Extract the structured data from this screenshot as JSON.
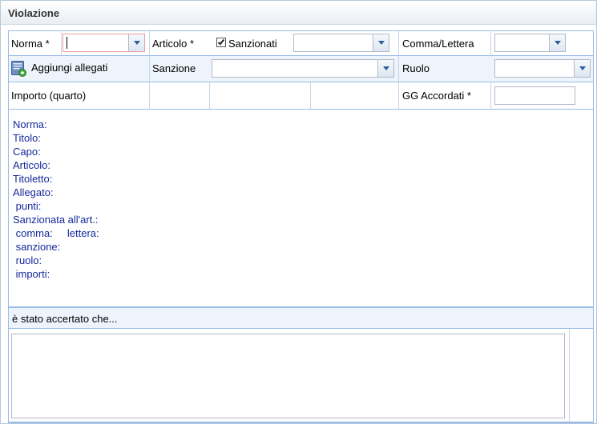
{
  "panel": {
    "title": "Violazione"
  },
  "row1": {
    "norma_label": "Norma *",
    "norma_value": "",
    "articolo_label": "Articolo *",
    "sanzionati_label": "Sanzionati",
    "sanzionati_checked": true,
    "articolo_value": "",
    "comma_label": "Comma/Lettera",
    "comma_value": ""
  },
  "row2": {
    "aggiungi_label": "Aggiungi allegati",
    "sanzione_label": "Sanzione",
    "sanzione_value": "",
    "ruolo_label": "Ruolo",
    "ruolo_value": ""
  },
  "row3": {
    "importo_label": "Importo (quarto)",
    "gg_label": "GG Accordati *",
    "gg_value": ""
  },
  "info": {
    "lines": [
      "Norma:",
      "Titolo:",
      "Capo:",
      "Articolo:",
      "Titoletto:",
      "Allegato:",
      " punti:",
      "Sanzionata all'art.:",
      " comma:     lettera:",
      " sanzione:",
      " ruolo:",
      " importi:"
    ]
  },
  "accertato": {
    "label": "è stato accertato che...",
    "value": ""
  },
  "colors": {
    "border": "#99bbe8",
    "info_text": "#15289c",
    "row_alt": "#edf4fb"
  }
}
